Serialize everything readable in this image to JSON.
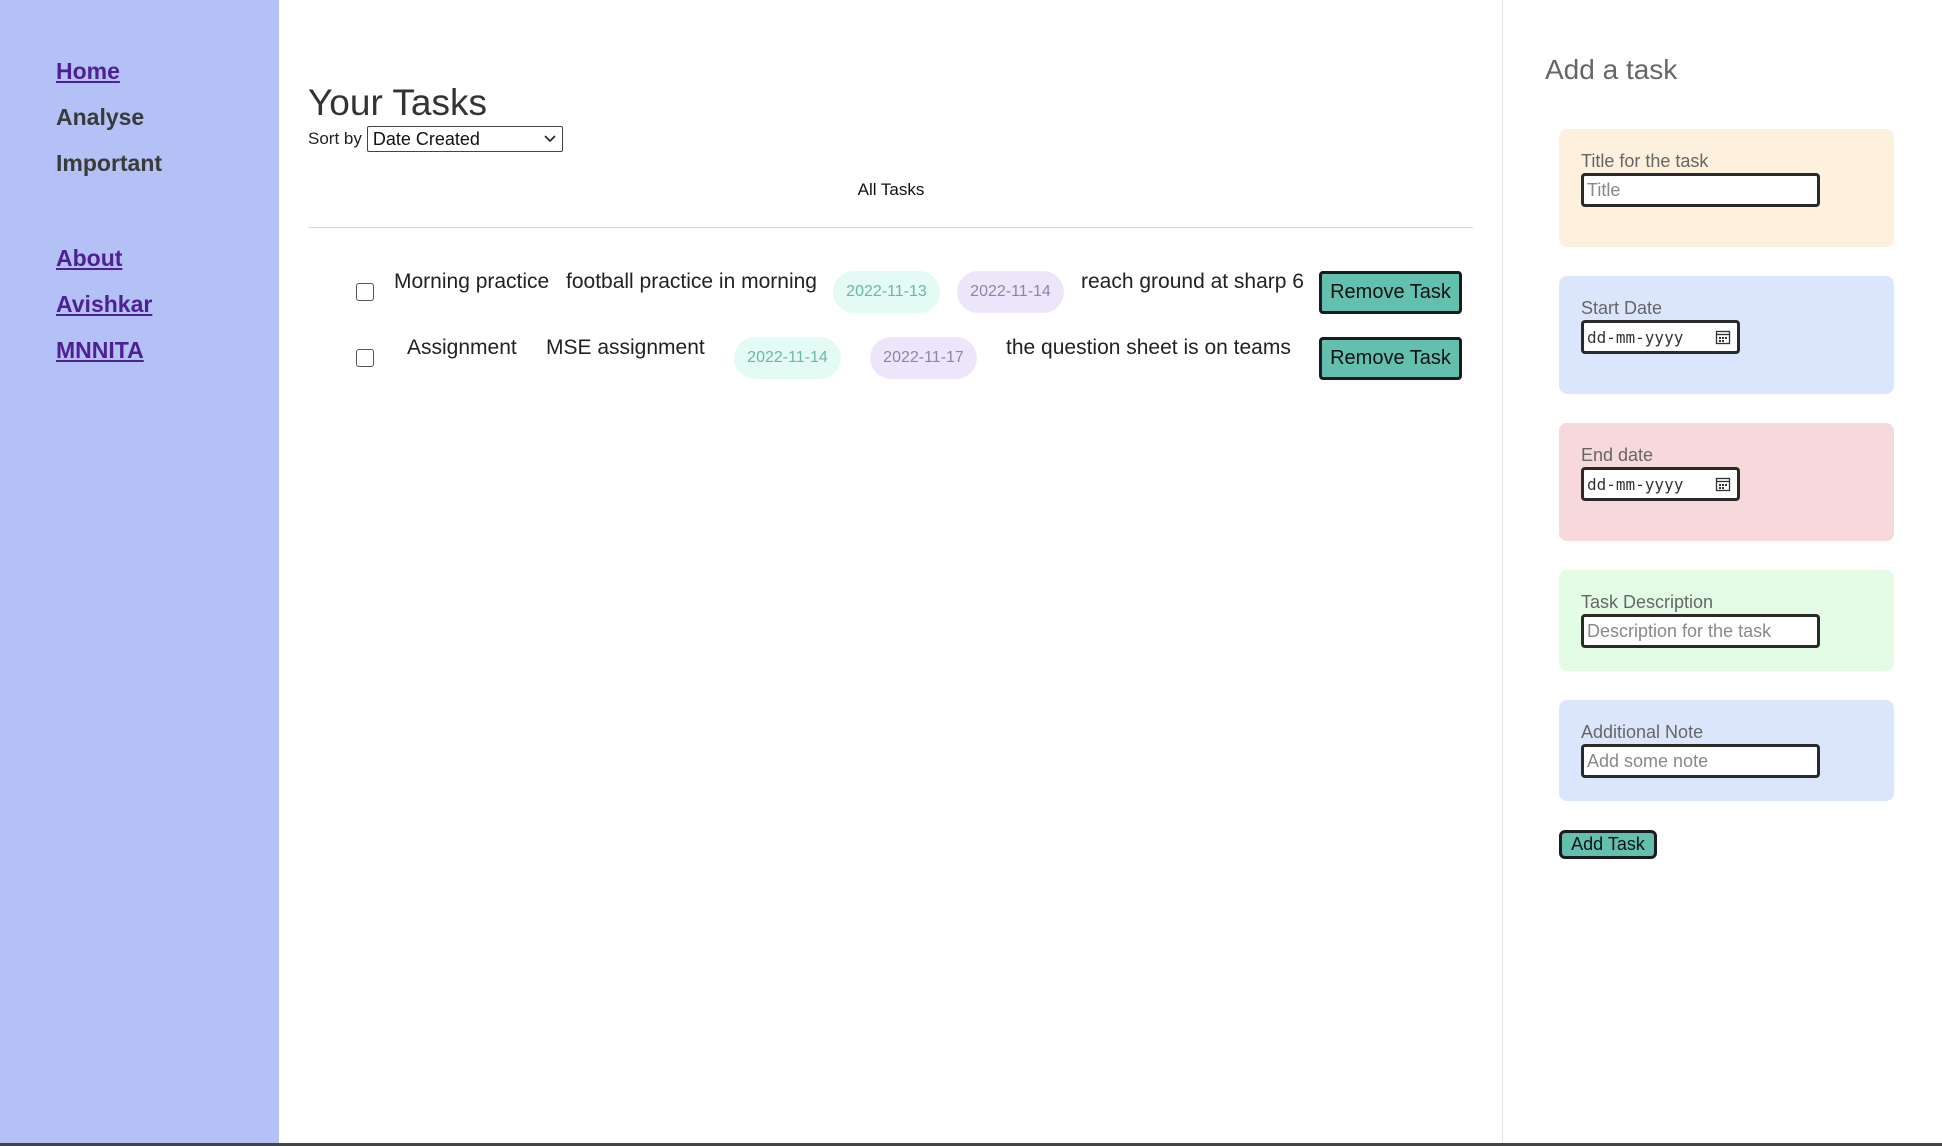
{
  "sidebar": {
    "items": [
      {
        "label": "Home"
      },
      {
        "label": "Analyse"
      },
      {
        "label": "Important"
      },
      {
        "label": "About"
      },
      {
        "label": "Avishkar"
      },
      {
        "label": "MNNITA"
      }
    ]
  },
  "main": {
    "title": "Your Tasks",
    "sort_label": "Sort by",
    "sort_value": "Date Created",
    "filter_label": "All Tasks",
    "tasks": [
      {
        "title": "Morning practice",
        "description": "football practice in morning",
        "start": "2022-11-13",
        "end": "2022-11-14",
        "note": "reach ground at sharp 6",
        "remove_label": "Remove Task"
      },
      {
        "title": "Assignment",
        "description": "MSE assignment",
        "start": "2022-11-14",
        "end": "2022-11-17",
        "note": "the question sheet is on teams",
        "remove_label": "Remove Task"
      }
    ]
  },
  "panel": {
    "title": "Add a task",
    "title_field": {
      "label": "Title for the task",
      "placeholder": "Title"
    },
    "start_field": {
      "label": "Start Date",
      "placeholder": "dd-mm-yyyy"
    },
    "end_field": {
      "label": "End date",
      "placeholder": "dd-mm-yyyy"
    },
    "description_field": {
      "label": "Task Description",
      "placeholder": "Description for the task"
    },
    "note_field": {
      "label": "Additional Note",
      "placeholder": "Add some note"
    },
    "add_label": "Add Task"
  },
  "colors": {
    "sidebar": "#b3c1f6",
    "accent_button": "#63bfae",
    "link": "#4f1f94",
    "card_title": "#fdf0dc",
    "card_start": "#dbe6fd",
    "card_end": "#f8d9db",
    "card_description": "#e3fce6",
    "card_note": "#dbe6fd"
  },
  "icons": {
    "sort_dropdown": "chevron-down-icon",
    "date_picker": "calendar-icon"
  }
}
